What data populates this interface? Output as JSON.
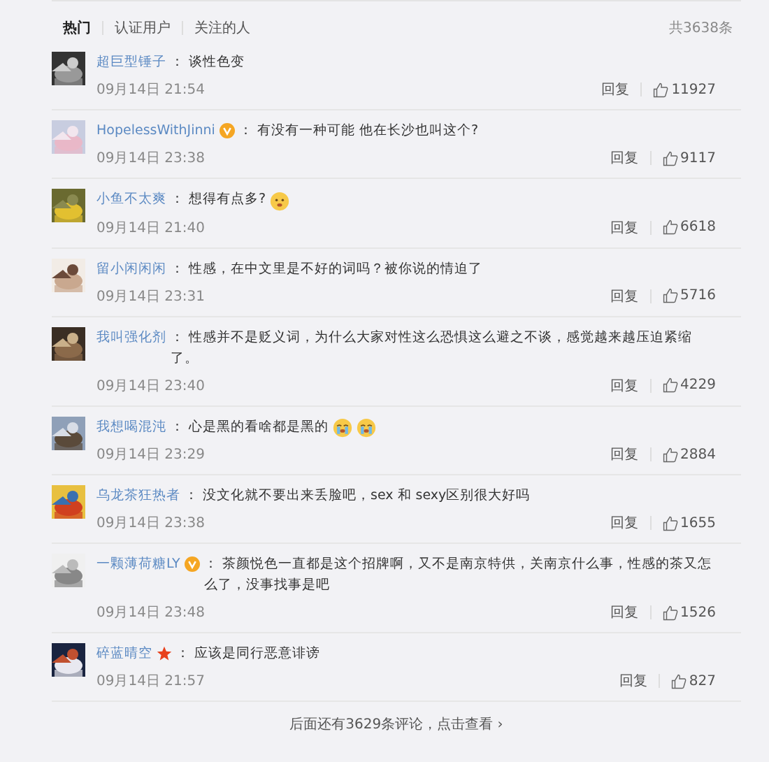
{
  "tabs": [
    {
      "label": "热门",
      "selected": true
    },
    {
      "label": "认证用户",
      "selected": false
    },
    {
      "label": "关注的人",
      "selected": false
    }
  ],
  "total": "共3638条",
  "comments": [
    {
      "user": "超巨型锤子",
      "text": "： 谈性色变",
      "time": "09月14日 21:54",
      "reply": "回复",
      "likes": "11927"
    },
    {
      "user": "HopelessWithJinni",
      "badges": [
        {
          "kind": "verified"
        }
      ],
      "text": "： 有没有一种可能 他在长沙也叫这个?",
      "time": "09月14日 23:38",
      "reply": "回复",
      "likes": "9117"
    },
    {
      "user": "小鱼不太爽",
      "text": "： 想得有点多?",
      "emojis": [
        {
          "kind": "puzzled"
        }
      ],
      "time": "09月14日 21:40",
      "reply": "回复",
      "likes": "6618"
    },
    {
      "user": "留小闲闲闲",
      "text": "： 性感，在中文里是不好的词吗？被你说的情迫了",
      "time": "09月14日 23:31",
      "reply": "回复",
      "likes": "5716"
    },
    {
      "user": "我叫强化剂",
      "text": "： 性感并不是贬义词，为什么大家对性这么恐惧这么避之不谈，感觉越来越压迫紧缩了。",
      "time": "09月14日 23:40",
      "reply": "回复",
      "likes": "4229"
    },
    {
      "user": "我想喝混沌",
      "text": "： 心是黑的看啥都是黑的",
      "emojis": [
        {
          "kind": "crying"
        },
        {
          "kind": "crying"
        }
      ],
      "time": "09月14日 23:29",
      "reply": "回复",
      "likes": "2884"
    },
    {
      "user": "乌龙茶狂热者",
      "text": "： 没文化就不要出来丢脸吧，sex 和 sexy区别很大好吗",
      "time": "09月14日 23:38",
      "reply": "回复",
      "likes": "1655"
    },
    {
      "user": "一颗薄荷糖LY",
      "badges": [
        {
          "kind": "verified"
        }
      ],
      "text": "： 茶颜悦色一直都是这个招牌啊，又不是南京特供，关南京什么事，性感的茶又怎么了，没事找事是吧",
      "time": "09月14日 23:48",
      "reply": "回复",
      "likes": "1526"
    },
    {
      "user": "碎蓝晴空",
      "badges": [
        {
          "kind": "star"
        }
      ],
      "text": "： 应该是同行恶意诽谤",
      "time": "09月14日 21:57",
      "reply": "回复",
      "likes": "827"
    }
  ],
  "more": "后面还有3629条评论，点击查看",
  "more_arrow": "›"
}
